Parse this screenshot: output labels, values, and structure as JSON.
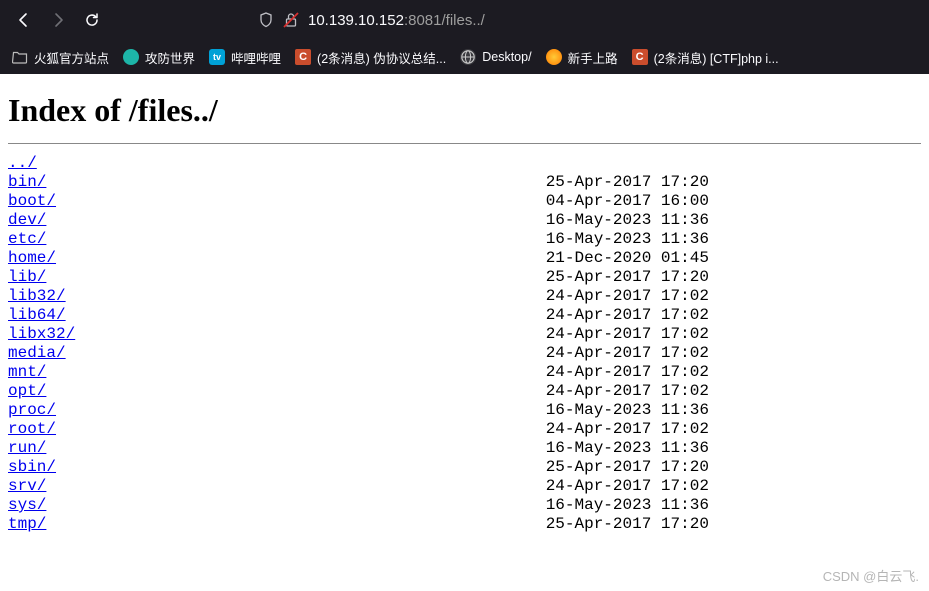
{
  "url": {
    "host": "10.139.10.152",
    "port": ":8081",
    "path": "/files../"
  },
  "bookmarks": [
    {
      "label": "火狐官方站点",
      "icon": "folder"
    },
    {
      "label": "攻防世界",
      "icon": "teal"
    },
    {
      "label": "哔哩哔哩",
      "icon": "bili"
    },
    {
      "label": "(2条消息) 伪协议总结...",
      "icon": "c-icon"
    },
    {
      "label": "Desktop/",
      "icon": "globe"
    },
    {
      "label": "新手上路",
      "icon": "ff"
    },
    {
      "label": "(2条消息) [CTF]php i...",
      "icon": "c-icon"
    }
  ],
  "page": {
    "title": "Index of /files../",
    "parent": "../",
    "entries": [
      {
        "name": "bin/",
        "date": "25-Apr-2017 17:20"
      },
      {
        "name": "boot/",
        "date": "04-Apr-2017 16:00"
      },
      {
        "name": "dev/",
        "date": "16-May-2023 11:36"
      },
      {
        "name": "etc/",
        "date": "16-May-2023 11:36"
      },
      {
        "name": "home/",
        "date": "21-Dec-2020 01:45"
      },
      {
        "name": "lib/",
        "date": "25-Apr-2017 17:20"
      },
      {
        "name": "lib32/",
        "date": "24-Apr-2017 17:02"
      },
      {
        "name": "lib64/",
        "date": "24-Apr-2017 17:02"
      },
      {
        "name": "libx32/",
        "date": "24-Apr-2017 17:02"
      },
      {
        "name": "media/",
        "date": "24-Apr-2017 17:02"
      },
      {
        "name": "mnt/",
        "date": "24-Apr-2017 17:02"
      },
      {
        "name": "opt/",
        "date": "24-Apr-2017 17:02"
      },
      {
        "name": "proc/",
        "date": "16-May-2023 11:36"
      },
      {
        "name": "root/",
        "date": "24-Apr-2017 17:02"
      },
      {
        "name": "run/",
        "date": "16-May-2023 11:36"
      },
      {
        "name": "sbin/",
        "date": "25-Apr-2017 17:20"
      },
      {
        "name": "srv/",
        "date": "24-Apr-2017 17:02"
      },
      {
        "name": "sys/",
        "date": "16-May-2023 11:36"
      },
      {
        "name": "tmp/",
        "date": "25-Apr-2017 17:20"
      }
    ]
  },
  "watermark": "CSDN @白云飞."
}
